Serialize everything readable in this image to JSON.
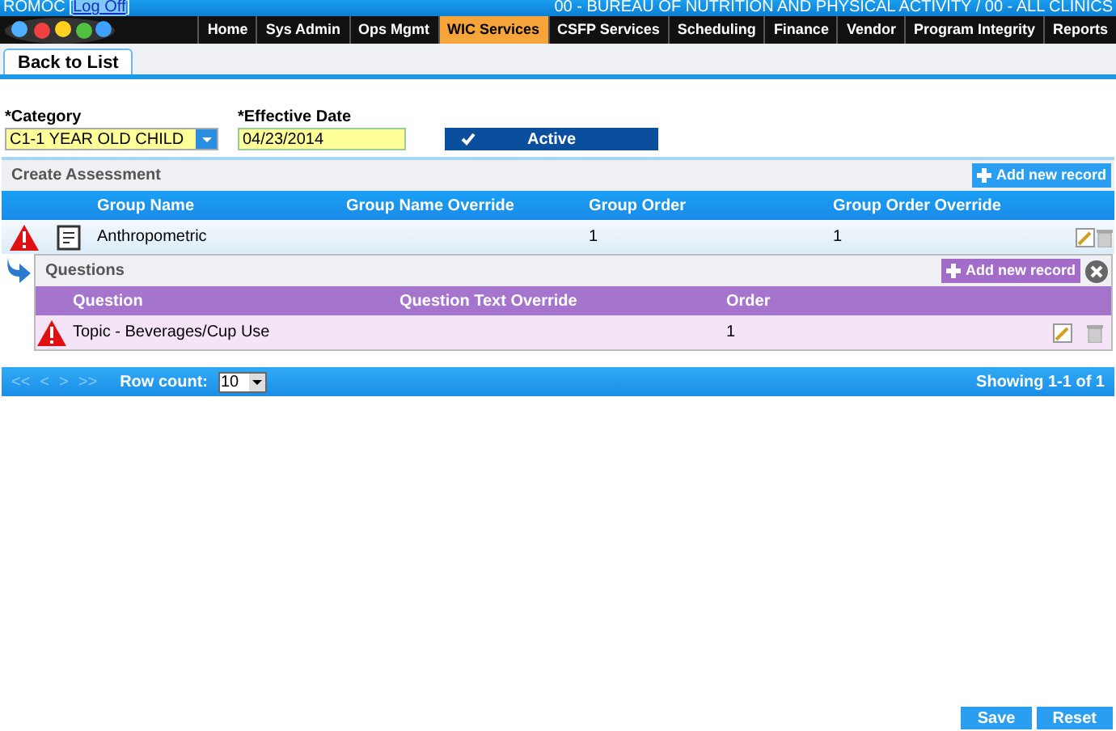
{
  "header": {
    "user": "ROMOC",
    "open_bracket": "[",
    "logoff": "Log Off",
    "close_bracket": "]",
    "agency": "00 - BUREAU OF NUTRITION AND PHYSICAL ACTIVITY / 00 - ALL CLINICS"
  },
  "nav": [
    {
      "label": "Home",
      "selected": false
    },
    {
      "label": "Sys Admin",
      "selected": false
    },
    {
      "label": "Ops Mgmt",
      "selected": false
    },
    {
      "label": "WIC Services",
      "selected": true
    },
    {
      "label": "CSFP Services",
      "selected": false
    },
    {
      "label": "Scheduling",
      "selected": false
    },
    {
      "label": "Finance",
      "selected": false
    },
    {
      "label": "Vendor",
      "selected": false
    },
    {
      "label": "Program Integrity",
      "selected": false
    },
    {
      "label": "Reports",
      "selected": false
    }
  ],
  "tabs": [
    {
      "label": "Back to List",
      "selected": true
    }
  ],
  "form": {
    "category": {
      "label": "*Category",
      "value": "C1-1 YEAR OLD CHILD"
    },
    "effective_date": {
      "label": "*Effective Date",
      "value": "04/23/2014"
    },
    "active": {
      "label": "Active",
      "checked": true
    }
  },
  "grid": {
    "title": "Create Assessment",
    "add_button": "Add new record",
    "columns": [
      "Group Name",
      "Group Name Override",
      "Group Order",
      "Group Order Override"
    ],
    "rows": [
      {
        "warning": true,
        "cells": [
          "Anthropometric",
          "",
          "1",
          "1"
        ],
        "expanded": true,
        "detail": {
          "title": "Questions",
          "add_button": "Add new record",
          "columns": [
            "Question",
            "Question Text Override",
            "Order"
          ],
          "rows": [
            {
              "warning": true,
              "cells": [
                "Topic - Beverages/Cup Use",
                "",
                "1"
              ]
            }
          ]
        }
      }
    ],
    "pager": {
      "first": "<<",
      "prev": "<",
      "next": ">",
      "last": ">>",
      "disabled": true,
      "row_count_label": "Row count:",
      "row_count": "10",
      "showing": "Showing 1-1 of 1"
    }
  },
  "buttons": [
    "Save",
    "Reset"
  ]
}
